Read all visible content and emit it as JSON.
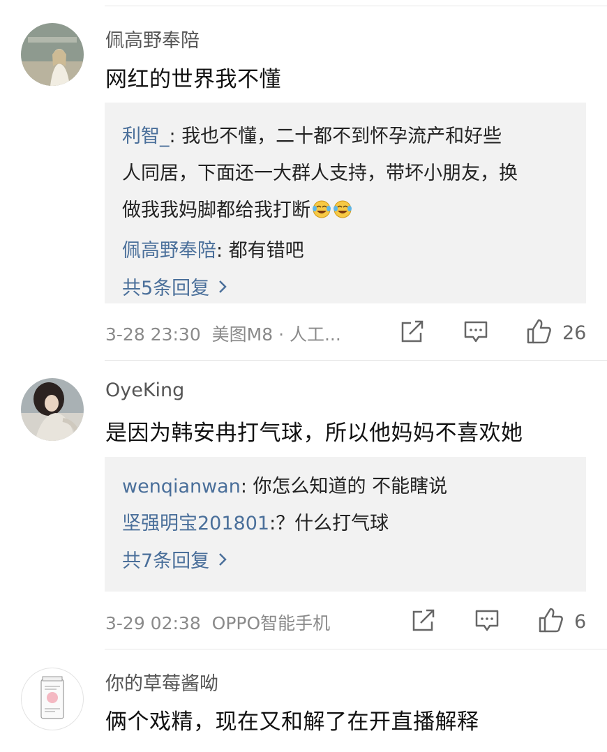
{
  "comments": [
    {
      "user": "佩高野奉陪",
      "text": "网红的世界我不懂",
      "replies": [
        {
          "name": "利智_",
          "sep": ": ",
          "line1": "我也不懂，二十都不到怀孕流产和好些",
          "line2": "人同居，下面还一大群人支持，带坏小朋友，换",
          "line3": "做我我妈脚都给我打断"
        },
        {
          "name": "佩高野奉陪",
          "sep": ": ",
          "text": "都有错吧"
        }
      ],
      "more_label": "共5条回复",
      "time": "3-28 23:30",
      "device": "美图M8 · 人工...",
      "likes": "26"
    },
    {
      "user": "OyeKing",
      "text": "是因为韩安冉打气球，所以他妈妈不喜欢她",
      "replies": [
        {
          "name": "wenqianwan",
          "sep": ": ",
          "text": "你怎么知道的 不能瞎说"
        },
        {
          "name": "坚强明宝201801",
          "sep": ":",
          "text": "？什么打气球"
        }
      ],
      "more_label": "共7条回复",
      "time": "3-29 02:38",
      "device": "OPPO智能手机",
      "likes": "6"
    },
    {
      "user": "你的草莓酱呦",
      "text": "俩个戏精，现在又和解了在开直播解释"
    }
  ],
  "icons": {
    "share": "share-icon",
    "comment": "comment-icon",
    "like": "thumbs-up-icon",
    "more": "chevron-right-icon",
    "emoji": "laughing-crying-emoji"
  },
  "colors": {
    "link": "#4a6f9a",
    "reply_bg": "#f2f2f2",
    "meta": "#8a8a8a"
  }
}
